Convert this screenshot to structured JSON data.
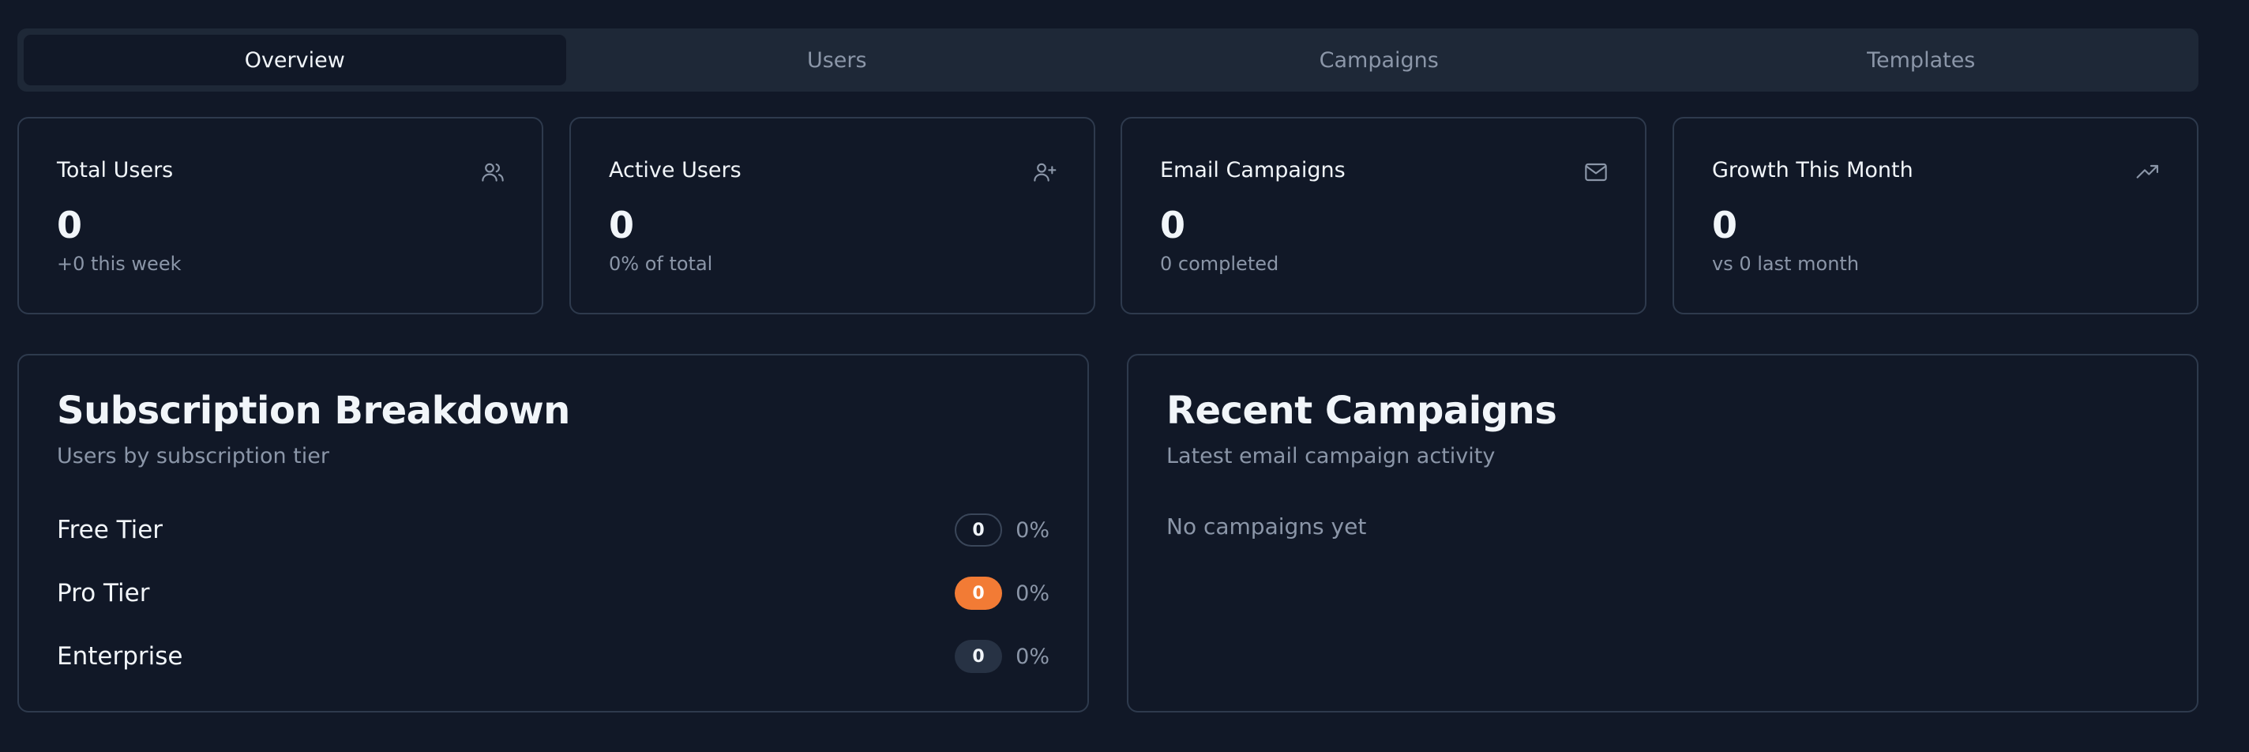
{
  "tabs": [
    {
      "label": "Overview",
      "active": true
    },
    {
      "label": "Users",
      "active": false
    },
    {
      "label": "Campaigns",
      "active": false
    },
    {
      "label": "Templates",
      "active": false
    }
  ],
  "stats": [
    {
      "title": "Total Users",
      "value": "0",
      "sub": "+0 this week",
      "icon": "users-icon"
    },
    {
      "title": "Active Users",
      "value": "0",
      "sub": "0% of total",
      "icon": "user-plus-icon"
    },
    {
      "title": "Email Campaigns",
      "value": "0",
      "sub": "0 completed",
      "icon": "mail-icon"
    },
    {
      "title": "Growth This Month",
      "value": "0",
      "sub": "vs 0 last month",
      "icon": "trending-up-icon"
    }
  ],
  "subscription": {
    "title": "Subscription Breakdown",
    "description": "Users by subscription tier",
    "tiers": [
      {
        "label": "Free Tier",
        "count": "0",
        "percent": "0%",
        "badge_style": "outline"
      },
      {
        "label": "Pro Tier",
        "count": "0",
        "percent": "0%",
        "badge_style": "orange"
      },
      {
        "label": "Enterprise",
        "count": "0",
        "percent": "0%",
        "badge_style": "gray"
      }
    ]
  },
  "campaigns": {
    "title": "Recent Campaigns",
    "description": "Latest email campaign activity",
    "empty_text": "No campaigns yet"
  },
  "colors": {
    "background": "#111827",
    "border": "#2e3a4d",
    "accent_orange": "#f27b35",
    "muted_text": "#8b96a8"
  }
}
